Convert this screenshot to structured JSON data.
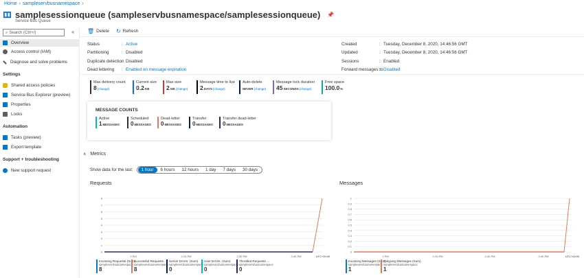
{
  "breadcrumb": {
    "home": "Home",
    "namespace": "sampleservbusnamespace"
  },
  "header": {
    "title": "samplesessionqueue (sampleservbusnamespace/samplesessionqueue)",
    "subtitle": "Service Bus Queue"
  },
  "sidebar": {
    "search_placeholder": "Search (Ctrl+/)",
    "collapse": "«",
    "items": [
      {
        "label": "Overview",
        "icon": "service-bus-icon"
      },
      {
        "label": "Access control (IAM)",
        "icon": "people-icon"
      },
      {
        "label": "Diagnose and solve problems",
        "icon": "wrench-icon"
      }
    ],
    "settings_title": "Settings",
    "settings": [
      {
        "label": "Shared access policies",
        "icon": "key-icon"
      },
      {
        "label": "Service Bus Explorer (preview)",
        "icon": "explorer-icon"
      },
      {
        "label": "Properties",
        "icon": "properties-icon"
      },
      {
        "label": "Locks",
        "icon": "lock-icon"
      }
    ],
    "automation_title": "Automation",
    "automation": [
      {
        "label": "Tasks (preview)",
        "icon": "tasks-icon"
      },
      {
        "label": "Export template",
        "icon": "export-icon"
      }
    ],
    "support_title": "Support + troubleshooting",
    "support": [
      {
        "label": "New support request",
        "icon": "support-icon"
      }
    ]
  },
  "toolbar": {
    "delete_label": "Delete",
    "refresh_label": "Refresh"
  },
  "essentials": {
    "left": [
      {
        "label": "Status",
        "value": "Active",
        "link": true
      },
      {
        "label": "Partitioning",
        "value": "Disabled",
        "link": false
      },
      {
        "label": "Duplicate detection",
        "value": "Disabled",
        "link": false
      },
      {
        "label": "Dead lettering",
        "value": "Enabled on message expiration",
        "link": true
      }
    ],
    "right": [
      {
        "label": "Created",
        "value": "Tuesday, December 8, 2020, 14:46:56 GMT",
        "link": false
      },
      {
        "label": "Updated",
        "value": "Tuesday, December 8, 2020, 14:46:56 GMT",
        "link": false
      },
      {
        "label": "Sessions",
        "value": "Enabled",
        "link": false
      },
      {
        "label": "Forward messages to",
        "value": "Disabled",
        "link": true
      }
    ]
  },
  "tiles": [
    {
      "label": "Max delivery count",
      "value": "8",
      "unit": "",
      "change": "(change)",
      "color": "#323130"
    },
    {
      "label": "Current size",
      "value": "0.2",
      "unit": "KB",
      "change": "",
      "color": "#0078d4"
    },
    {
      "label": "Max size",
      "value": "2",
      "unit": "GB",
      "change": "(change)",
      "color": "#d13438"
    },
    {
      "label": "Message time to live",
      "value": "2",
      "unit": "DAYS",
      "change": "(change)",
      "color": "#000000"
    },
    {
      "label": "Auto-delete",
      "value": "",
      "unit": "NEVER",
      "change": "(change)",
      "color": "#002050"
    },
    {
      "label": "Message lock duration",
      "value": "45",
      "unit": "SECONDS",
      "change": "(change)",
      "color": "#8764b8"
    },
    {
      "label": "Free space",
      "value": "100.0",
      "unit": "%",
      "change": "",
      "color": "#00b294"
    }
  ],
  "message_counts": {
    "title": "MESSAGE COUNTS",
    "items": [
      {
        "label": "Active",
        "value": "1",
        "unit": "MESSAGES",
        "color": "#00b7c3"
      },
      {
        "label": "Scheduled",
        "value": "0",
        "unit": "MESSAGES",
        "color": "#323130"
      },
      {
        "label": "Dead-letter",
        "value": "0",
        "unit": "MESSAGES",
        "color": "#e07a5f"
      },
      {
        "label": "Transfer",
        "value": "0",
        "unit": "MESSAGES",
        "color": "#002050"
      },
      {
        "label": "Transfer dead-letter",
        "value": "0",
        "unit": "MESSAGES",
        "color": "#3b1f66"
      }
    ]
  },
  "metrics": {
    "title": "Metrics",
    "show_label": "Show data for the last:",
    "ranges": [
      "1 hour",
      "6 hours",
      "12 hours",
      "1 day",
      "7 days",
      "30 days"
    ],
    "selected": "1 hour"
  },
  "charts": {
    "requests": {
      "title": "Requests",
      "y_ticks": [
        "8",
        "7",
        "6",
        "5",
        "4",
        "3",
        "2",
        "1",
        "0"
      ],
      "x_ticks": [
        "2 PM",
        "2:15 PM",
        "2:30 PM",
        "2:45 PM"
      ],
      "tz": "UTC+00:00",
      "legend": [
        {
          "label": "Incoming Requests (Sum)",
          "sub": "sampleservbusnamespace",
          "value": "8",
          "color": "#0078d4"
        },
        {
          "label": "Successful Requests ...",
          "sub": "sampleservbusnamespace",
          "value": "8",
          "color": "#e07a5f"
        },
        {
          "label": "Server Errors. (Sum)",
          "sub": "sampleservbusnamespace",
          "value": "0",
          "color": "#002050"
        },
        {
          "label": "User Errors. (Sum)",
          "sub": "sampleservbusnamespace",
          "value": "0",
          "color": "#00b7c3"
        },
        {
          "label": "Throttled Requests ...",
          "sub": "sampleservbusnamespace",
          "value": "0",
          "color": "#3b1f66"
        }
      ]
    },
    "messages": {
      "title": "Messages",
      "y_ticks": [
        "1",
        "0.9",
        "0.8",
        "0.7",
        "0.6",
        "0.5",
        "0.4",
        "0.3",
        "0.2",
        "0.1",
        "0"
      ],
      "x_ticks": [
        "2 PM",
        "2:15 PM",
        "2:30 PM",
        "2:45 PM"
      ],
      "tz": "UTC+00:00",
      "legend": [
        {
          "label": "Incoming Messages (Sum)",
          "sub": "sampleservbusnamespace",
          "value": "1",
          "color": "#0078d4"
        },
        {
          "label": "Outgoing Messages (Sum)",
          "sub": "sampleservbusnamespace",
          "value": "1",
          "color": "#e07a5f"
        }
      ]
    }
  }
}
